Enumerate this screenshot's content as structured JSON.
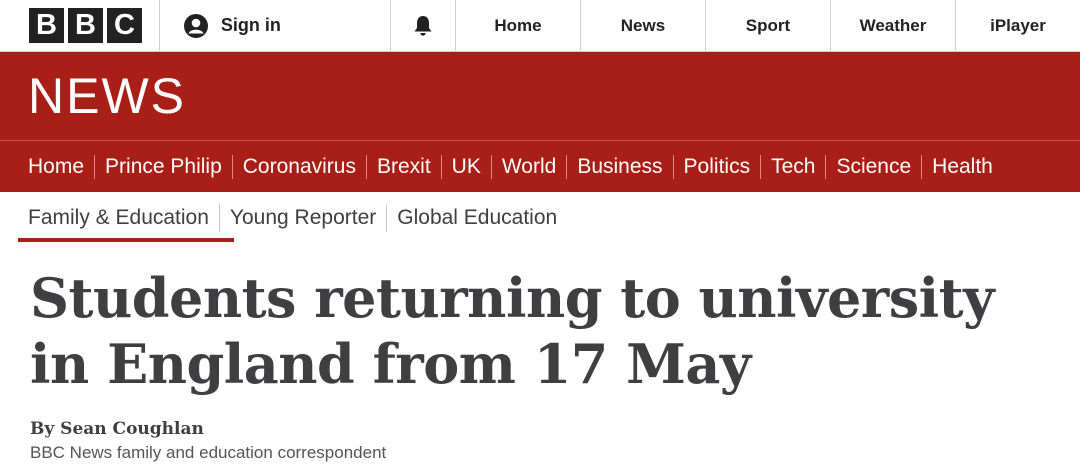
{
  "brand": {
    "logo_letters": [
      "B",
      "B",
      "C"
    ]
  },
  "topbar": {
    "sign_in_label": "Sign in",
    "nav": [
      "Home",
      "News",
      "Sport",
      "Weather",
      "iPlayer"
    ]
  },
  "banner": {
    "title": "NEWS"
  },
  "main_nav": [
    "Home",
    "Prince Philip",
    "Coronavirus",
    "Brexit",
    "UK",
    "World",
    "Business",
    "Politics",
    "Tech",
    "Science",
    "Health"
  ],
  "sub_nav": {
    "items": [
      "Family & Education",
      "Young Reporter",
      "Global Education"
    ],
    "active": "Family & Education"
  },
  "article": {
    "headline": "Students returning to university in England from 17 May",
    "author": "By Sean Coughlan",
    "role": "BBC News family and education correspondent"
  },
  "colors": {
    "accent": "#a91e16",
    "text": "#3f3f42"
  },
  "icons": [
    "user-icon",
    "bell-icon"
  ]
}
